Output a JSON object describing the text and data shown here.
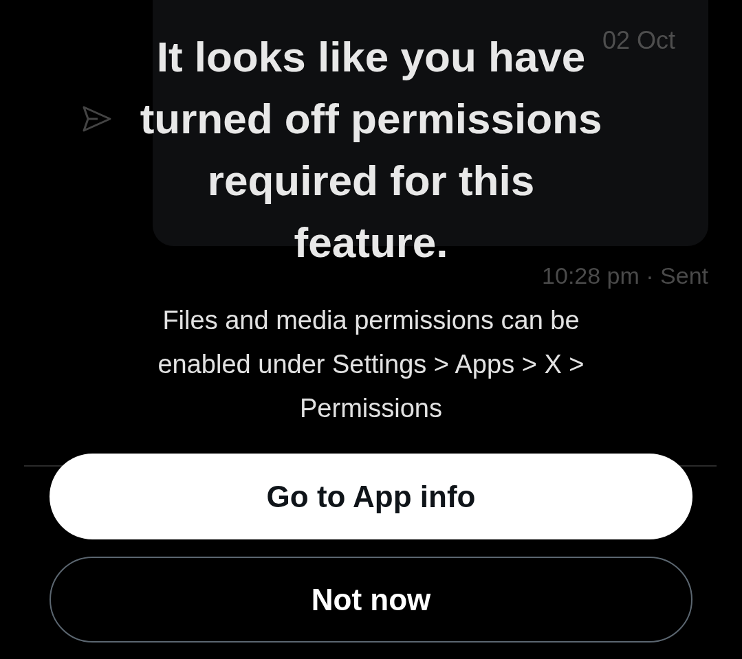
{
  "background": {
    "message": {
      "date": "02 Oct",
      "time": "10:28 pm · Sent"
    }
  },
  "dialog": {
    "title": "It looks like you have turned off permissions required for this feature.",
    "body": "Files and media permissions can be enabled under Settings > Apps > X > Permissions",
    "buttons": [
      {
        "kind": "primary",
        "label": "Go to App info"
      },
      {
        "kind": "secondary",
        "label": "Not now"
      }
    ]
  }
}
